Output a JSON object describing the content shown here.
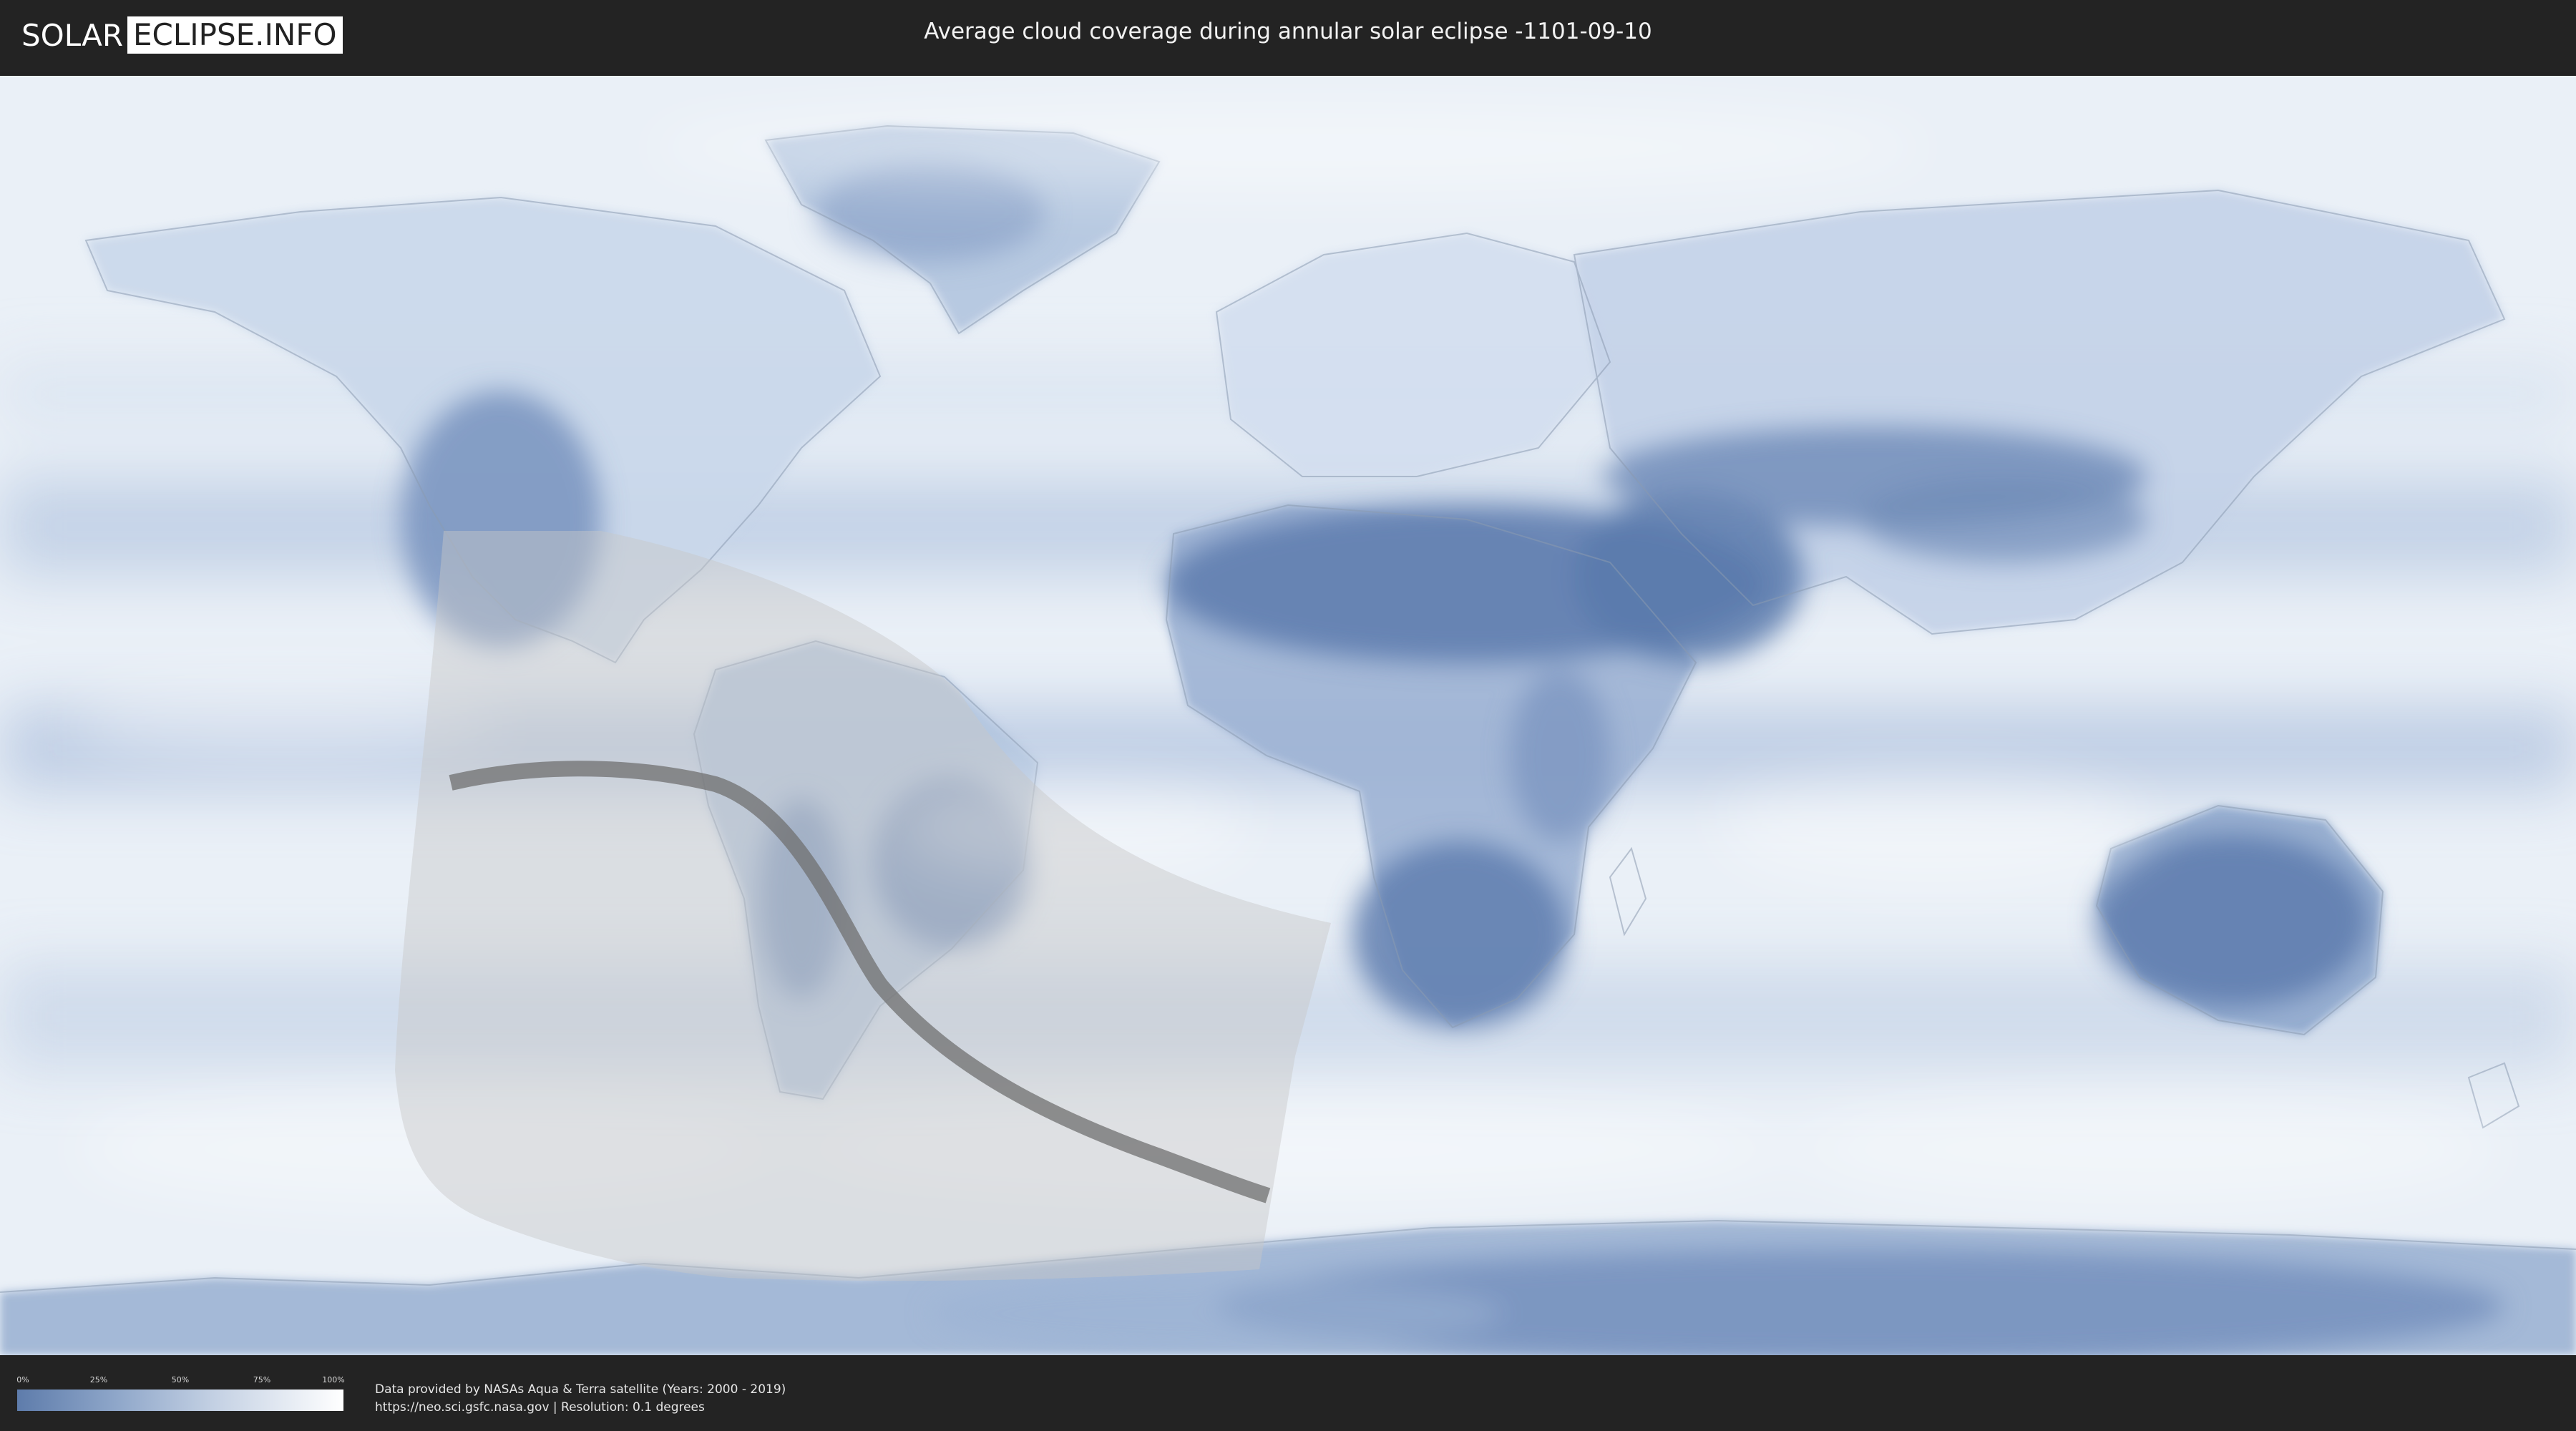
{
  "header": {
    "logo_left": "SOLAR",
    "logo_right": "ECLIPSE.INFO",
    "title": "Average cloud coverage during annular solar eclipse -1101-09-10"
  },
  "map": {
    "subject": "average cloud coverage world map",
    "colors": {
      "ocean_cloudy": "#eef3f9",
      "clear_sky": "#5f7eaf",
      "mid_cover": "#9fb5d5",
      "eclipse_overlay": "#c9c9c9",
      "central_path": "#707070"
    }
  },
  "legend": {
    "ticks": [
      "0%",
      "25%",
      "50%",
      "75%",
      "100%"
    ],
    "gradient_start": "#5e7cab",
    "gradient_end": "#ffffff"
  },
  "footer": {
    "credit_line1": "Data provided by NASAs Aqua & Terra satellite (Years: 2000 - 2019)",
    "credit_line2": "https://neo.sci.gsfc.nasa.gov | Resolution: 0.1 degrees"
  }
}
